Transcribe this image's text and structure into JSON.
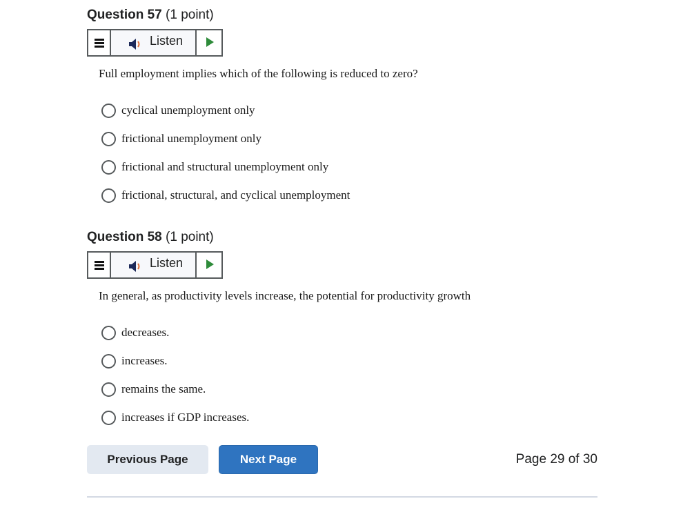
{
  "questions": [
    {
      "number": "Question 57",
      "points": "(1 point)",
      "listen_label": "Listen",
      "prompt": "Full employment implies which of the following is reduced to zero?",
      "options": [
        "cyclical unemployment only",
        "frictional unemployment only",
        "frictional and structural unemployment only",
        "frictional, structural, and cyclical unemployment"
      ]
    },
    {
      "number": "Question 58",
      "points": "(1 point)",
      "listen_label": "Listen",
      "prompt": "In general, as productivity levels increase, the potential for productivity growth",
      "options": [
        "decreases.",
        "increases.",
        "remains the same.",
        "increases if GDP increases."
      ]
    }
  ],
  "navigation": {
    "previous_label": "Previous Page",
    "next_label": "Next Page",
    "page_indicator": "Page 29 of 30"
  },
  "icons": {
    "menu": "menu-icon",
    "speaker": "speaker-icon",
    "play": "play-icon"
  },
  "colors": {
    "next_button": "#2f74c0",
    "prev_button": "#e3e9f1",
    "play_icon": "#2e8b3a",
    "speaker_wave": "#e0703a"
  }
}
